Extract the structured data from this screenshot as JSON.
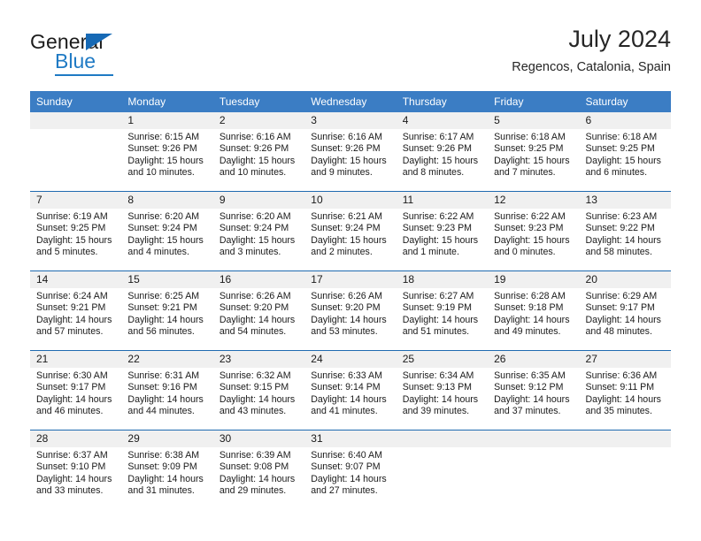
{
  "brand": {
    "name_top": "General",
    "name_bottom": "Blue",
    "triangle_color": "#1669b5",
    "blue_color": "#1f7ac4"
  },
  "header": {
    "title": "July 2024",
    "subtitle": "Regencos, Catalonia, Spain",
    "header_bg": "#3b7dc4",
    "daynum_bg": "#f0f0f0",
    "row_divider": "#1f6ab0"
  },
  "weekdays": [
    "Sunday",
    "Monday",
    "Tuesday",
    "Wednesday",
    "Thursday",
    "Friday",
    "Saturday"
  ],
  "weeks": [
    [
      {
        "day": "",
        "empty": true
      },
      {
        "day": "1",
        "sunrise": "Sunrise: 6:15 AM",
        "sunset": "Sunset: 9:26 PM",
        "daylight": "Daylight: 15 hours and 10 minutes."
      },
      {
        "day": "2",
        "sunrise": "Sunrise: 6:16 AM",
        "sunset": "Sunset: 9:26 PM",
        "daylight": "Daylight: 15 hours and 10 minutes."
      },
      {
        "day": "3",
        "sunrise": "Sunrise: 6:16 AM",
        "sunset": "Sunset: 9:26 PM",
        "daylight": "Daylight: 15 hours and 9 minutes."
      },
      {
        "day": "4",
        "sunrise": "Sunrise: 6:17 AM",
        "sunset": "Sunset: 9:26 PM",
        "daylight": "Daylight: 15 hours and 8 minutes."
      },
      {
        "day": "5",
        "sunrise": "Sunrise: 6:18 AM",
        "sunset": "Sunset: 9:25 PM",
        "daylight": "Daylight: 15 hours and 7 minutes."
      },
      {
        "day": "6",
        "sunrise": "Sunrise: 6:18 AM",
        "sunset": "Sunset: 9:25 PM",
        "daylight": "Daylight: 15 hours and 6 minutes."
      }
    ],
    [
      {
        "day": "7",
        "sunrise": "Sunrise: 6:19 AM",
        "sunset": "Sunset: 9:25 PM",
        "daylight": "Daylight: 15 hours and 5 minutes."
      },
      {
        "day": "8",
        "sunrise": "Sunrise: 6:20 AM",
        "sunset": "Sunset: 9:24 PM",
        "daylight": "Daylight: 15 hours and 4 minutes."
      },
      {
        "day": "9",
        "sunrise": "Sunrise: 6:20 AM",
        "sunset": "Sunset: 9:24 PM",
        "daylight": "Daylight: 15 hours and 3 minutes."
      },
      {
        "day": "10",
        "sunrise": "Sunrise: 6:21 AM",
        "sunset": "Sunset: 9:24 PM",
        "daylight": "Daylight: 15 hours and 2 minutes."
      },
      {
        "day": "11",
        "sunrise": "Sunrise: 6:22 AM",
        "sunset": "Sunset: 9:23 PM",
        "daylight": "Daylight: 15 hours and 1 minute."
      },
      {
        "day": "12",
        "sunrise": "Sunrise: 6:22 AM",
        "sunset": "Sunset: 9:23 PM",
        "daylight": "Daylight: 15 hours and 0 minutes."
      },
      {
        "day": "13",
        "sunrise": "Sunrise: 6:23 AM",
        "sunset": "Sunset: 9:22 PM",
        "daylight": "Daylight: 14 hours and 58 minutes."
      }
    ],
    [
      {
        "day": "14",
        "sunrise": "Sunrise: 6:24 AM",
        "sunset": "Sunset: 9:21 PM",
        "daylight": "Daylight: 14 hours and 57 minutes."
      },
      {
        "day": "15",
        "sunrise": "Sunrise: 6:25 AM",
        "sunset": "Sunset: 9:21 PM",
        "daylight": "Daylight: 14 hours and 56 minutes."
      },
      {
        "day": "16",
        "sunrise": "Sunrise: 6:26 AM",
        "sunset": "Sunset: 9:20 PM",
        "daylight": "Daylight: 14 hours and 54 minutes."
      },
      {
        "day": "17",
        "sunrise": "Sunrise: 6:26 AM",
        "sunset": "Sunset: 9:20 PM",
        "daylight": "Daylight: 14 hours and 53 minutes."
      },
      {
        "day": "18",
        "sunrise": "Sunrise: 6:27 AM",
        "sunset": "Sunset: 9:19 PM",
        "daylight": "Daylight: 14 hours and 51 minutes."
      },
      {
        "day": "19",
        "sunrise": "Sunrise: 6:28 AM",
        "sunset": "Sunset: 9:18 PM",
        "daylight": "Daylight: 14 hours and 49 minutes."
      },
      {
        "day": "20",
        "sunrise": "Sunrise: 6:29 AM",
        "sunset": "Sunset: 9:17 PM",
        "daylight": "Daylight: 14 hours and 48 minutes."
      }
    ],
    [
      {
        "day": "21",
        "sunrise": "Sunrise: 6:30 AM",
        "sunset": "Sunset: 9:17 PM",
        "daylight": "Daylight: 14 hours and 46 minutes."
      },
      {
        "day": "22",
        "sunrise": "Sunrise: 6:31 AM",
        "sunset": "Sunset: 9:16 PM",
        "daylight": "Daylight: 14 hours and 44 minutes."
      },
      {
        "day": "23",
        "sunrise": "Sunrise: 6:32 AM",
        "sunset": "Sunset: 9:15 PM",
        "daylight": "Daylight: 14 hours and 43 minutes."
      },
      {
        "day": "24",
        "sunrise": "Sunrise: 6:33 AM",
        "sunset": "Sunset: 9:14 PM",
        "daylight": "Daylight: 14 hours and 41 minutes."
      },
      {
        "day": "25",
        "sunrise": "Sunrise: 6:34 AM",
        "sunset": "Sunset: 9:13 PM",
        "daylight": "Daylight: 14 hours and 39 minutes."
      },
      {
        "day": "26",
        "sunrise": "Sunrise: 6:35 AM",
        "sunset": "Sunset: 9:12 PM",
        "daylight": "Daylight: 14 hours and 37 minutes."
      },
      {
        "day": "27",
        "sunrise": "Sunrise: 6:36 AM",
        "sunset": "Sunset: 9:11 PM",
        "daylight": "Daylight: 14 hours and 35 minutes."
      }
    ],
    [
      {
        "day": "28",
        "sunrise": "Sunrise: 6:37 AM",
        "sunset": "Sunset: 9:10 PM",
        "daylight": "Daylight: 14 hours and 33 minutes."
      },
      {
        "day": "29",
        "sunrise": "Sunrise: 6:38 AM",
        "sunset": "Sunset: 9:09 PM",
        "daylight": "Daylight: 14 hours and 31 minutes."
      },
      {
        "day": "30",
        "sunrise": "Sunrise: 6:39 AM",
        "sunset": "Sunset: 9:08 PM",
        "daylight": "Daylight: 14 hours and 29 minutes."
      },
      {
        "day": "31",
        "sunrise": "Sunrise: 6:40 AM",
        "sunset": "Sunset: 9:07 PM",
        "daylight": "Daylight: 14 hours and 27 minutes."
      },
      {
        "day": "",
        "empty": true
      },
      {
        "day": "",
        "empty": true
      },
      {
        "day": "",
        "empty": true
      }
    ]
  ]
}
